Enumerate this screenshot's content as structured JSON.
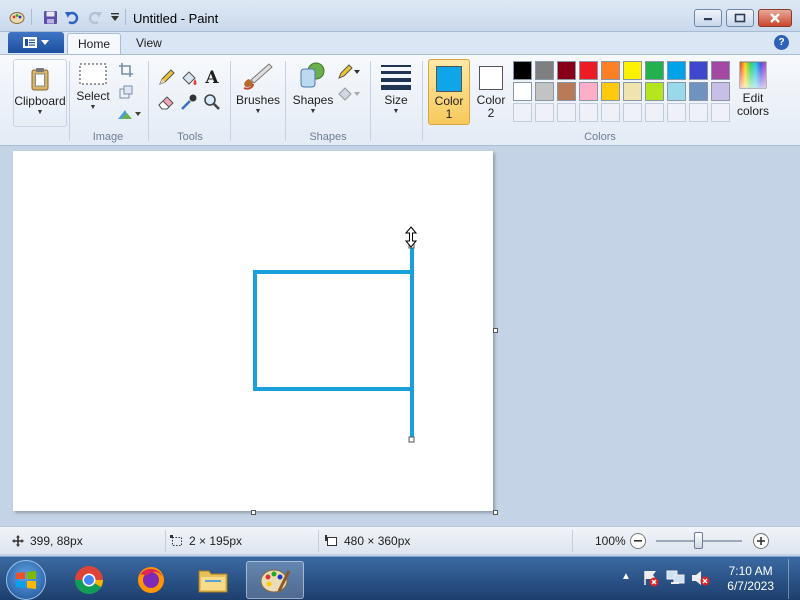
{
  "window": {
    "title": "Untitled - Paint"
  },
  "tabs": [
    {
      "label": "Home"
    },
    {
      "label": "View"
    }
  ],
  "ribbon": {
    "clipboard": {
      "label": "Clipboard"
    },
    "image": {
      "select_label": "Select",
      "group_label": "Image"
    },
    "tools": {
      "group_label": "Tools"
    },
    "brushes": {
      "label": "Brushes"
    },
    "shapes": {
      "label": "Shapes",
      "group_label": "Shapes"
    },
    "size": {
      "label": "Size"
    },
    "color1": {
      "label_line1": "Color",
      "label_line2": "1",
      "value": "#0ea5e9"
    },
    "color2": {
      "label_line1": "Color",
      "label_line2": "2",
      "value": "#ffffff"
    },
    "colors": {
      "group_label": "Colors"
    },
    "edit_colors": {
      "label_line1": "Edit",
      "label_line2": "colors"
    }
  },
  "palette": {
    "row1": [
      "#000000",
      "#7f7f7f",
      "#880015",
      "#ed1c24",
      "#ff7f27",
      "#fff200",
      "#22b14c",
      "#00a2e8",
      "#3f48cc",
      "#a349a4"
    ],
    "row2": [
      "#ffffff",
      "#c3c3c3",
      "#b97a57",
      "#ffaec9",
      "#ffc90e",
      "#efe4b0",
      "#b5e61d",
      "#99d9ea",
      "#7092be",
      "#c8bfe7"
    ]
  },
  "status": {
    "cursor_pos": "399, 88px",
    "selection_size": "2 × 195px",
    "image_size": "480 × 360px",
    "zoom": "100%"
  },
  "taskbar": {
    "time": "7:10 AM",
    "date": "6/7/2023"
  },
  "drawing": {
    "stroke_color": "#1a9fdb"
  }
}
